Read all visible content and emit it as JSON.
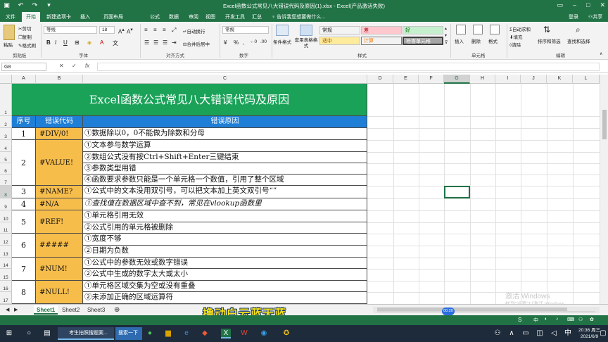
{
  "window": {
    "title": "Excel函数公式常见八大错误代码及原因(1).xlsx - Excel(产品激活失败)",
    "login": "登录",
    "share": "共享"
  },
  "tabs": [
    "文件",
    "开始",
    "新建选项卡",
    "插入",
    "页面布局",
    "公式",
    "数据",
    "审阅",
    "视图",
    "开发工具",
    "汇总"
  ],
  "tell_me": "告诉我您想要做什么...",
  "ribbon": {
    "clipboard": {
      "paste": "粘贴",
      "cut": "剪切",
      "copy": "复制",
      "format_painter": "格式刷",
      "label": "剪贴板"
    },
    "font": {
      "name": "等线",
      "size": "18",
      "label": "字体"
    },
    "alignment": {
      "wrap": "自动换行",
      "merge": "合并后居中",
      "label": "对齐方式"
    },
    "number": {
      "format": "常规",
      "label": "数字"
    },
    "styles": {
      "conditional": "条件格式",
      "table": "套用表格格式",
      "cells": [
        {
          "text": "常规",
          "bg": "#ffffff",
          "fg": "#222222"
        },
        {
          "text": "差",
          "bg": "#ffc7ce",
          "fg": "#9c0006"
        },
        {
          "text": "好",
          "bg": "#c6efce",
          "fg": "#006100"
        },
        {
          "text": "适中",
          "bg": "#ffeb9c",
          "fg": "#9c5700"
        },
        {
          "text": "计算",
          "bg": "#f2f2f2",
          "fg": "#fa7d00"
        },
        {
          "text": "检查单元格",
          "bg": "#a5a5a5",
          "fg": "#ffffff"
        }
      ],
      "label": "样式"
    },
    "cells_group": {
      "insert": "插入",
      "delete": "删除",
      "format": "格式",
      "label": "单元格"
    },
    "editing": {
      "autosum": "自动求和",
      "fill": "填充",
      "clear": "清除",
      "sort": "排序和筛选",
      "find": "查找和选择",
      "label": "编辑"
    }
  },
  "formula_bar": {
    "name_box": "G8",
    "fx": "fx"
  },
  "columns": [
    "A",
    "B",
    "C",
    "D",
    "E",
    "F",
    "G",
    "H",
    "I",
    "J",
    "K",
    "L"
  ],
  "rows": [
    "1",
    "2",
    "3",
    "4",
    "5",
    "6",
    "7",
    "8",
    "9",
    "10",
    "11",
    "12",
    "13",
    "14",
    "15",
    "16",
    "17"
  ],
  "sheet": {
    "title": "Excel函数公式常见八大错误代码及原因",
    "headers": [
      "序号",
      "错误代码",
      "错误原因"
    ],
    "groups": [
      {
        "no": "1",
        "code": "#DIV/0!",
        "reasons": [
          "①数据除以0，0不能做为除数和分母"
        ]
      },
      {
        "no": "2",
        "code": "#VALUE!",
        "reasons": [
          "①文本参与数学运算",
          "②数组公式没有按Ctrl+Shift+Enter三键结束",
          "③参数类型用错",
          "④函数要求参数只能是一个单元格一个数值，引用了整个区域"
        ]
      },
      {
        "no": "3",
        "code": "#NAME?",
        "reasons": [
          "①公式中的文本没用双引号，可以把文本加上英文双引号“”"
        ]
      },
      {
        "no": "4",
        "code": "#N/A",
        "reasons": [
          "①查找值在数据区域中查不到，常见在vlookup函数里"
        ]
      },
      {
        "no": "5",
        "code": "#REF!",
        "reasons": [
          "①单元格引用无效",
          "②公式引用的单元格被删除"
        ]
      },
      {
        "no": "6",
        "code": "#####",
        "reasons": [
          "①宽度不够",
          "②日期为负数"
        ]
      },
      {
        "no": "7",
        "code": "#NUM!",
        "reasons": [
          "①公式中的参数无效或数字错误",
          "②公式中生成的数字太大或太小"
        ]
      },
      {
        "no": "8",
        "code": "#NULL!",
        "reasons": [
          "①单元格区域交集为空或没有重叠",
          "②未添加正确的区域运算符"
        ]
      }
    ]
  },
  "sheet_tabs": [
    "Sheet1",
    "Sheet2",
    "Sheet3"
  ],
  "caption": "撸动白云蓝天蓝",
  "video_time": "00:20",
  "watermark": {
    "line1": "激活 Windows",
    "line2": "转到\"设置\"以激活 Windows。"
  },
  "taskbar": {
    "app1": "考生拍照搜题案...",
    "search": "搜索一下",
    "time": "20:36 周三",
    "date": "2021/6/9"
  },
  "colors": {
    "excel_green": "#217346",
    "title_fill": "#1aa259",
    "header_fill": "#1f7fd6",
    "code_fill": "#f7bd4b"
  }
}
